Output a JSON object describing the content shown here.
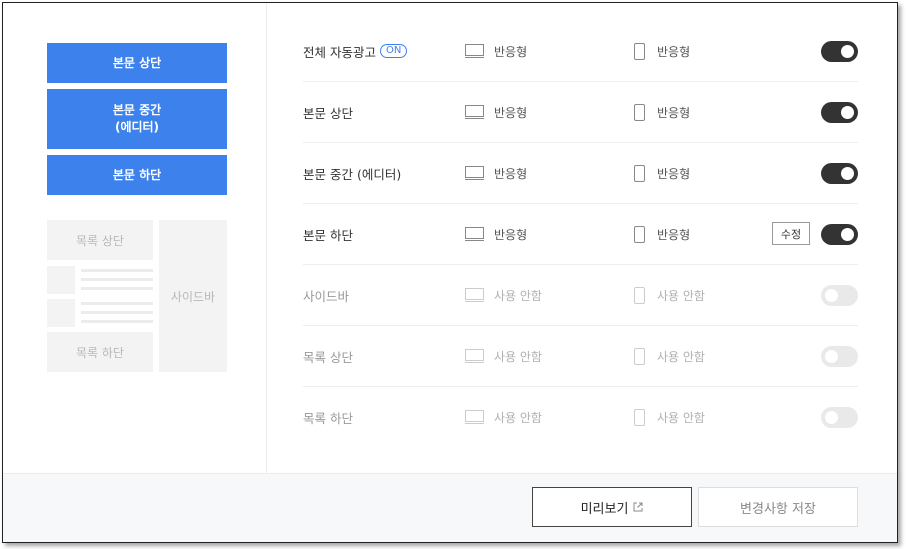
{
  "left": {
    "blue_buttons": [
      "본문 상단",
      "본문 중간\n(에디터)",
      "본문 하단"
    ],
    "layout_preview": {
      "list_top": "목록 상단",
      "list_bottom": "목록 하단",
      "sidebar": "사이드바"
    }
  },
  "rows": [
    {
      "label": "전체 자동광고",
      "badge": "ON",
      "pc": "반응형",
      "mobile": "반응형",
      "enabled": true,
      "edit": null
    },
    {
      "label": "본문 상단",
      "badge": null,
      "pc": "반응형",
      "mobile": "반응형",
      "enabled": true,
      "edit": null
    },
    {
      "label": "본문 중간 (에디터)",
      "badge": null,
      "pc": "반응형",
      "mobile": "반응형",
      "enabled": true,
      "edit": null
    },
    {
      "label": "본문 하단",
      "badge": null,
      "pc": "반응형",
      "mobile": "반응형",
      "enabled": true,
      "edit": "수정"
    },
    {
      "label": "사이드바",
      "badge": null,
      "pc": "사용 안함",
      "mobile": "사용 안함",
      "enabled": false,
      "edit": null
    },
    {
      "label": "목록 상단",
      "badge": null,
      "pc": "사용 안함",
      "mobile": "사용 안함",
      "enabled": false,
      "edit": null
    },
    {
      "label": "목록 하단",
      "badge": null,
      "pc": "사용 안함",
      "mobile": "사용 안함",
      "enabled": false,
      "edit": null
    }
  ],
  "footer": {
    "preview_label": "미리보기",
    "save_label": "변경사항 저장"
  },
  "colors": {
    "accent": "#3d82ec",
    "toggle_on": "#333333",
    "toggle_off": "#e9e9e9"
  },
  "icons": {
    "pc": "monitor-icon",
    "mobile": "mobile-icon",
    "preview": "external-link-icon"
  }
}
